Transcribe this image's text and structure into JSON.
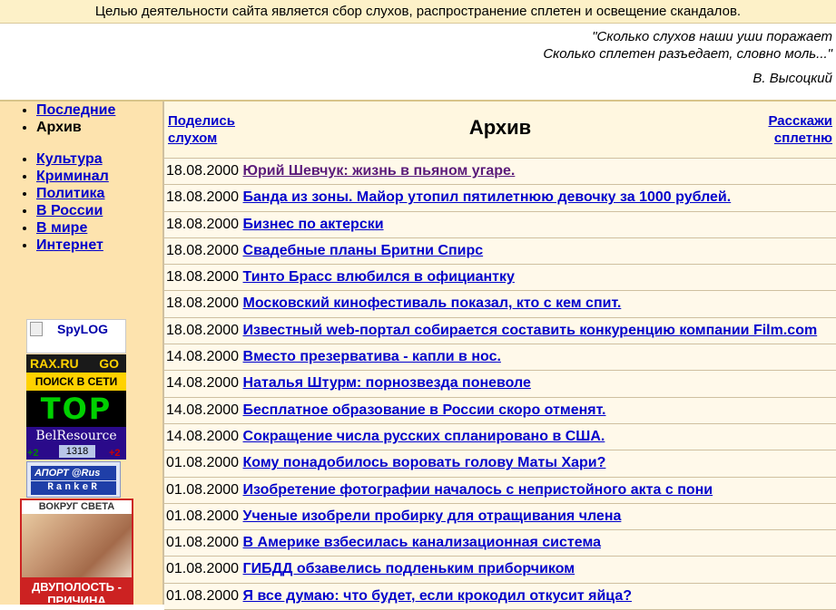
{
  "topbar": {
    "text": "Целью деятельности сайта является сбор слухов, распространение сплетен и освещение скандалов."
  },
  "quote": {
    "line1": "\"Сколько слухов наши уши поражает",
    "line2": "Сколько сплетен разъедает, словно моль...\"",
    "author": "В. Высоцкий"
  },
  "sidebar": {
    "nav1": [
      {
        "label": "Последние",
        "link": true
      },
      {
        "label": "Архив",
        "link": false
      }
    ],
    "nav2": [
      {
        "label": "Культура"
      },
      {
        "label": "Криминал"
      },
      {
        "label": "Политика"
      },
      {
        "label": "В России"
      },
      {
        "label": "В мире"
      },
      {
        "label": "Интернет"
      }
    ],
    "banners": {
      "spylog": "SpyLOG",
      "rax1": "RAX.RU",
      "rax_go": "GO",
      "rax2": "ПОИСК В СЕТИ",
      "top": "TOP",
      "belres": "BelResource",
      "belres_num": "1318",
      "plus_left": "+2",
      "plus_right": "+2",
      "aport1": "АПОРТ @Rus",
      "aport2": "RankeR",
      "vokrug_head": "ВОКРУГ СВЕТА",
      "vokrug_cap": "ДВУПОЛОСТЬ - ПРИЧИНА РАЗУМА"
    }
  },
  "archive": {
    "share_label": "Поделись слухом",
    "title": "Архив",
    "tell_label": "Расскажи сплетню",
    "items": [
      {
        "date": "18.08.2000",
        "title": "Юрий Шевчук: жизнь в пьяном угаре.",
        "visited": true
      },
      {
        "date": "18.08.2000",
        "title": "Банда из зоны. Майор утопил пятилетнюю девочку за 1000 рублей."
      },
      {
        "date": "18.08.2000",
        "title": "Бизнес по актерски"
      },
      {
        "date": "18.08.2000",
        "title": "Свадебные планы Бритни Спирс"
      },
      {
        "date": "18.08.2000",
        "title": "Тинто Брасс влюбился в официантку"
      },
      {
        "date": "18.08.2000",
        "title": "Московский кинофестиваль показал, кто с кем спит."
      },
      {
        "date": "18.08.2000",
        "title": "Известный web-портал собирается составить конкуренцию компании Film.com"
      },
      {
        "date": "14.08.2000",
        "title": "Вместо презерватива - капли в нос."
      },
      {
        "date": "14.08.2000",
        "title": "Наталья Штурм: порнозвезда поневоле"
      },
      {
        "date": "14.08.2000",
        "title": "Бесплатное образование в России скоро отменят."
      },
      {
        "date": "14.08.2000",
        "title": "Сокращение числа русских спланировано в США."
      },
      {
        "date": "01.08.2000",
        "title": "Кому понадобилось воровать голову Маты Хари?"
      },
      {
        "date": "01.08.2000",
        "title": "Изобретение фотографии началось с непристойного акта с пони"
      },
      {
        "date": "01.08.2000",
        "title": "Ученые изобрели пробирку для отращивания члена"
      },
      {
        "date": "01.08.2000",
        "title": "В Америке взбесилась канализационная система"
      },
      {
        "date": "01.08.2000",
        "title": "ГИБДД обзавелись подленьким приборчиком"
      },
      {
        "date": "01.08.2000",
        "title": "Я все думаю: что будет, если крокодил откусит яйца?"
      }
    ]
  }
}
